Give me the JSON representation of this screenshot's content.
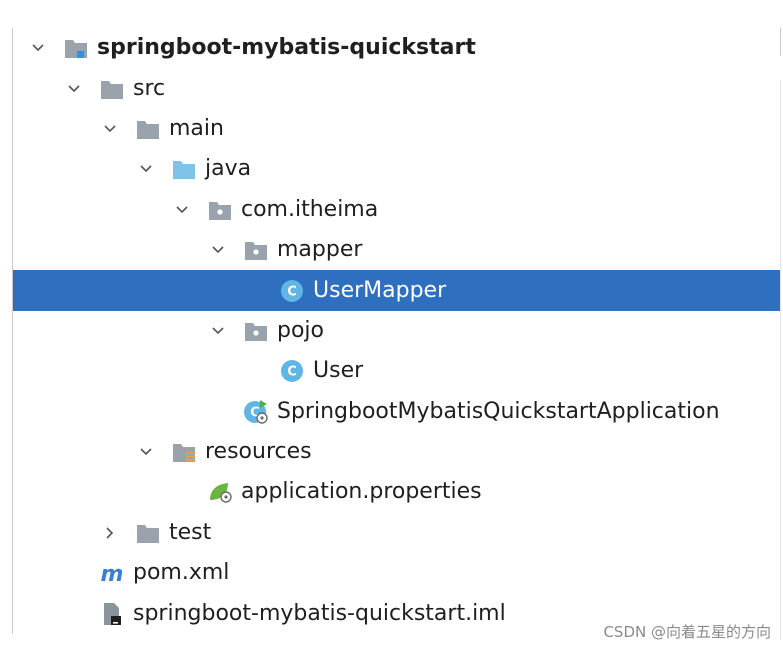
{
  "tree": {
    "items": [
      {
        "label": "springboot-mybatis-quickstart",
        "icon": "module-folder-icon",
        "expanded": true
      },
      {
        "label": "src",
        "icon": "folder-icon",
        "expanded": true
      },
      {
        "label": "main",
        "icon": "folder-icon",
        "expanded": true
      },
      {
        "label": "java",
        "icon": "source-root-folder-icon",
        "expanded": true
      },
      {
        "label": "com.itheima",
        "icon": "package-icon",
        "expanded": true
      },
      {
        "label": "mapper",
        "icon": "package-icon",
        "expanded": true
      },
      {
        "label": "UserMapper",
        "icon": "class-icon",
        "selected": true
      },
      {
        "label": "pojo",
        "icon": "package-icon",
        "expanded": true
      },
      {
        "label": "User",
        "icon": "class-icon"
      },
      {
        "label": "SpringbootMybatisQuickstartApplication",
        "icon": "spring-boot-class-icon"
      },
      {
        "label": "resources",
        "icon": "resources-folder-icon",
        "expanded": true
      },
      {
        "label": "application.properties",
        "icon": "spring-properties-icon"
      },
      {
        "label": "test",
        "icon": "folder-icon",
        "expanded": false
      },
      {
        "label": "pom.xml",
        "icon": "maven-icon"
      },
      {
        "label": "springboot-mybatis-quickstart.iml",
        "icon": "iml-file-icon"
      }
    ]
  },
  "watermark": "CSDN @向着五星的方向",
  "colors": {
    "selection": "#2f6fbf",
    "folder": "#9aa3ab",
    "source_folder": "#7fc4e8",
    "class_icon": "#5fb5e6"
  }
}
